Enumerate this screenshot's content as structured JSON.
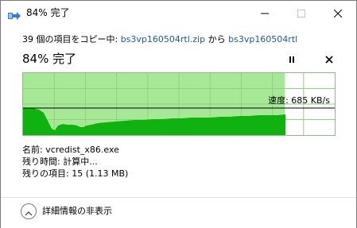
{
  "window": {
    "title": "84% 完了"
  },
  "copy": {
    "prefix": "39 個の項目をコピー中: ",
    "source": "bs3vp160504rtl.zip",
    "middle": " から ",
    "destination": "bs3vp160504rtl"
  },
  "progress": {
    "status_text": "84% 完了",
    "percent": 84,
    "speed_text": "速度: 685 KB/s"
  },
  "details": {
    "name_label": "名前:",
    "name_value": "vcredist_x86.exe",
    "time_label": "残り時間:",
    "time_value": "計算中...",
    "items_label": "残りの項目:",
    "items_value": "15 (1.13 MB)"
  },
  "footer": {
    "toggle_label": "詳細情報の非表示"
  },
  "icons": {
    "window": "copy-arrow-icon",
    "minimize": "minimize-icon",
    "maximize": "maximize-icon",
    "close": "close-icon",
    "pause": "pause-icon",
    "cancel": "cancel-icon",
    "collapse": "chevron-up-icon"
  },
  "colors": {
    "graph_progress_fill": "#a6e896",
    "graph_speed_fill": "#10b210",
    "graph_grid": "#8fd27f",
    "link": "#1a5aa8"
  }
}
